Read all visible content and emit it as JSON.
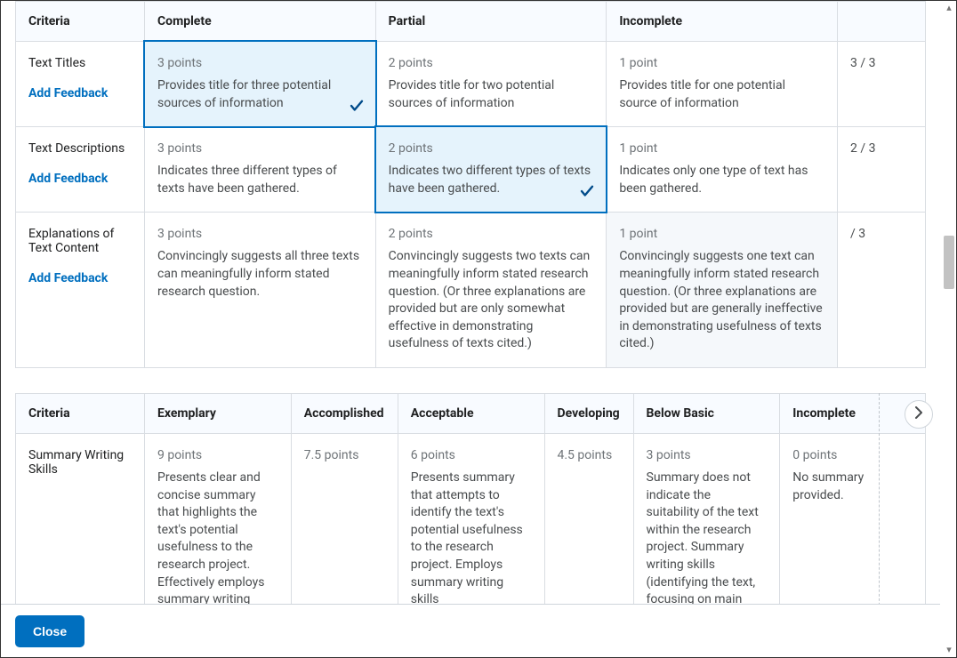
{
  "rubric1": {
    "headers": {
      "criteria": "Criteria",
      "l1": "Complete",
      "l2": "Partial",
      "l3": "Incomplete",
      "score": ""
    },
    "feedback_label": "Add Feedback",
    "rows": [
      {
        "criterion": "Text Titles",
        "levels": [
          {
            "points": "3 points",
            "desc": "Provides title for three potential sources of information",
            "selected": true
          },
          {
            "points": "2 points",
            "desc": "Provides title for two potential sources of information"
          },
          {
            "points": "1 point",
            "desc": "Provides title for one potential source of information"
          }
        ],
        "score": "3 / 3"
      },
      {
        "criterion": "Text Descriptions",
        "levels": [
          {
            "points": "3 points",
            "desc": "Indicates three different types of texts have been gathered."
          },
          {
            "points": "2 points",
            "desc": "Indicates two different types of texts have been gathered.",
            "selected": true
          },
          {
            "points": "1 point",
            "desc": "Indicates only one type of text has been gathered."
          }
        ],
        "score": "2 / 3"
      },
      {
        "criterion": "Explanations of Text Content",
        "levels": [
          {
            "points": "3 points",
            "desc": "Convincingly suggests all three texts can meaningfully inform stated research question."
          },
          {
            "points": "2 points",
            "desc": "Convincingly suggests two texts can meaningfully inform stated research question. (Or three explanations are provided but are only somewhat effective in demonstrating usefulness of texts cited.)"
          },
          {
            "points": "1 point",
            "desc": "Convincingly suggests one text can meaningfully inform stated research question. (Or three explanations are provided but are generally ineffective in demonstrating usefulness of texts cited.)",
            "hover": true
          }
        ],
        "score": "/ 3"
      }
    ]
  },
  "rubric2": {
    "headers": {
      "criteria": "Criteria",
      "l1": "Exemplary",
      "l2": "Accomplished",
      "l3": "Acceptable",
      "l4": "Developing",
      "l5": "Below Basic",
      "l6": "Incomplete"
    },
    "row": {
      "criterion": "Summary Writing Skills",
      "levels": [
        {
          "points": "9 points",
          "desc": "Presents clear and concise summary that highlights the text's potential usefulness to the research project. Effectively employs summary writing skills:"
        },
        {
          "points": "7.5 points",
          "desc": ""
        },
        {
          "points": "6 points",
          "desc": "Presents summary that attempts to identify the text's potential usefulness to the research project. Employs summary writing skills"
        },
        {
          "points": "4.5 points",
          "desc": ""
        },
        {
          "points": "3 points",
          "desc": "Summary does not indicate the suitability of the text within the research project. Summary writing skills (identifying the text, focusing on main"
        },
        {
          "points": "0 points",
          "desc": "No summary provided."
        }
      ]
    }
  },
  "footer": {
    "close": "Close"
  }
}
